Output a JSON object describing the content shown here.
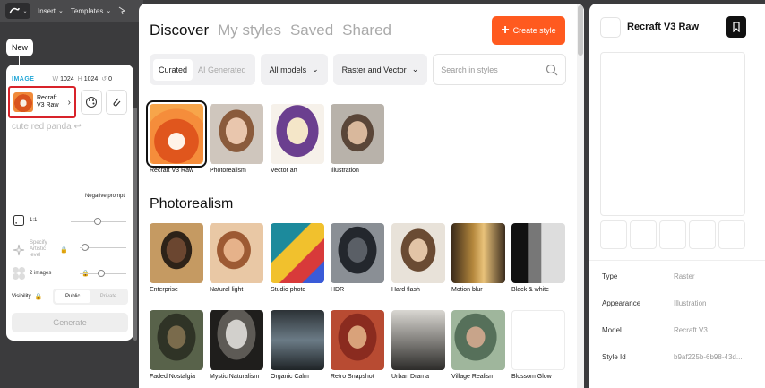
{
  "topbar": {
    "menus": [
      "Insert",
      "Templates"
    ]
  },
  "left_panel": {
    "new_label": "New",
    "image_label": "IMAGE",
    "width_key": "W",
    "width_value": "1024",
    "height_key": "H",
    "height_value": "1024",
    "count_key": "↺",
    "count_value": "0",
    "model_name": "Recraft V3 Raw",
    "prompt": "cute red panda ↩",
    "negative_prompt": "Negative prompt",
    "aspect_ratio": "1:1",
    "artistic_level": "Specify Artistic level",
    "images_count": "2 images",
    "visibility_label": "Visibility",
    "visibility_public": "Public",
    "visibility_private": "Private",
    "generate_label": "Generate"
  },
  "main": {
    "tabs": [
      {
        "label": "Discover"
      },
      {
        "label": "My styles"
      },
      {
        "label": "Saved"
      },
      {
        "label": "Shared"
      }
    ],
    "create_label": "Create style",
    "segment": {
      "curated": "Curated",
      "ai": "AI Generated"
    },
    "models_dropdown": "All models",
    "type_dropdown": "Raster and Vector",
    "search_placeholder": "Search in styles",
    "featured": [
      {
        "label": "Recraft V3 Raw"
      },
      {
        "label": "Photorealism"
      },
      {
        "label": "Vector art"
      },
      {
        "label": "Illustration"
      }
    ],
    "section_title": "Photorealism",
    "row1": [
      {
        "label": "Enterprise"
      },
      {
        "label": "Natural light"
      },
      {
        "label": "Studio photo"
      },
      {
        "label": "HDR"
      },
      {
        "label": "Hard flash"
      },
      {
        "label": "Motion blur"
      },
      {
        "label": "Black & white"
      }
    ],
    "row2": [
      {
        "label": "Faded Nostalgia"
      },
      {
        "label": "Mystic Naturalism"
      },
      {
        "label": "Organic Calm"
      },
      {
        "label": "Retro Snapshot"
      },
      {
        "label": "Urban Drama"
      },
      {
        "label": "Village Realism"
      },
      {
        "label": "Blossom Glow"
      }
    ]
  },
  "right_panel": {
    "title": "Recraft V3 Raw",
    "details": [
      {
        "key": "Type",
        "value": "Raster"
      },
      {
        "key": "Appearance",
        "value": "Illustration"
      },
      {
        "key": "Model",
        "value": "Recraft V3"
      },
      {
        "key": "Style Id",
        "value": "b9af225b-6b98-43d..."
      }
    ]
  },
  "colors": {
    "accent": "#ff5a1f",
    "selection_border": "#d8232a",
    "image_label": "#21a6d6"
  }
}
